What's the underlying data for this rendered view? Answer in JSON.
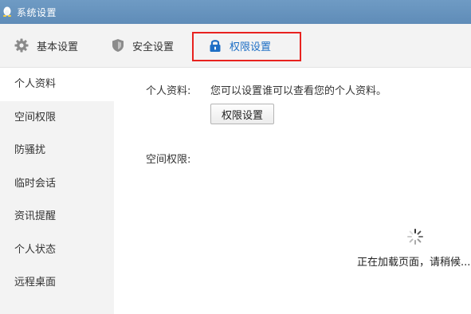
{
  "window": {
    "title": "系统设置"
  },
  "tabs": {
    "basic": "基本设置",
    "security": "安全设置",
    "permissions": "权限设置"
  },
  "sidebar": {
    "items": [
      {
        "label": "个人资料"
      },
      {
        "label": "空间权限"
      },
      {
        "label": "防骚扰"
      },
      {
        "label": "临时会话"
      },
      {
        "label": "资讯提醒"
      },
      {
        "label": "个人状态"
      },
      {
        "label": "远程桌面"
      }
    ]
  },
  "main": {
    "profile_label": "个人资料:",
    "profile_desc": "您可以设置谁可以查看您的个人资料。",
    "profile_button": "权限设置",
    "space_label": "空间权限:",
    "loading_text": "正在加载页面，请稍候..."
  },
  "colors": {
    "titlebar": "#6894bf",
    "active_tab": "#1f6fc5",
    "highlight": "#e8221f",
    "sidebar_bg": "#f3f3f3"
  },
  "icons": {
    "app": "penguin-icon",
    "basic": "gear-icon",
    "security": "shield-icon",
    "permissions": "lock-icon",
    "loading": "spinner-icon"
  }
}
